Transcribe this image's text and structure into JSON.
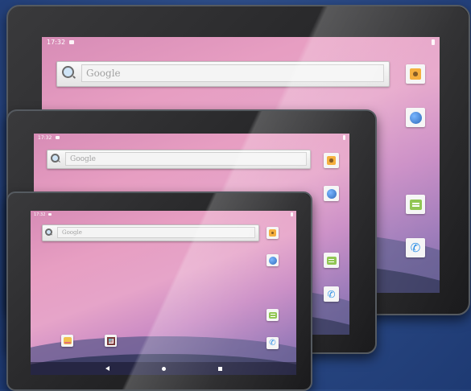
{
  "tablets": [
    {
      "size": "large",
      "status": {
        "time": "17:32"
      },
      "search": {
        "placeholder": "Google"
      },
      "dock_icons": [
        "camera-icon",
        "browser-icon",
        "messaging-icon",
        "phone-icon"
      ]
    },
    {
      "size": "medium",
      "status": {
        "time": "17:32"
      },
      "search": {
        "placeholder": "Google"
      },
      "dock_icons": [
        "camera-icon",
        "browser-icon",
        "messaging-icon",
        "phone-icon"
      ]
    },
    {
      "size": "small",
      "status": {
        "time": "17:32"
      },
      "search": {
        "placeholder": "Google"
      },
      "dock_icons": [
        "camera-icon",
        "browser-icon",
        "messaging-icon",
        "phone-icon"
      ],
      "home_icons": [
        "email-icon",
        "gallery-icon"
      ],
      "nav_buttons": [
        "back-button",
        "home-button",
        "recents-button"
      ]
    }
  ],
  "colors": {
    "background": "#2b4a86",
    "bezel": "#2a2a2c",
    "wallpaper_top": "#e79ec2",
    "wallpaper_bottom": "#7a6aa6"
  }
}
